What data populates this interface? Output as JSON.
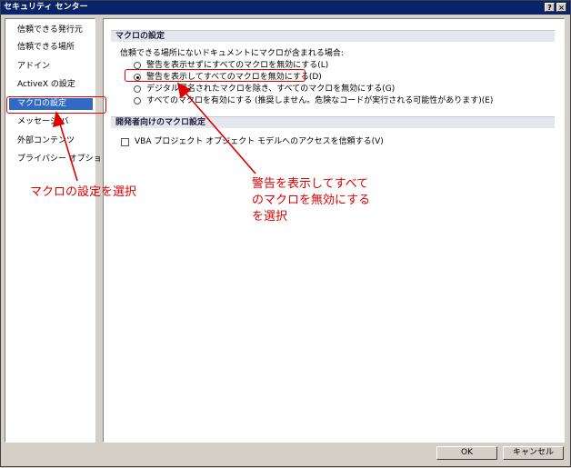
{
  "window": {
    "title": "セキュリティ センター",
    "help_label": "?",
    "close_label": "×"
  },
  "sidebar": {
    "items": [
      {
        "label": "信頼できる発行元"
      },
      {
        "label": "信頼できる場所"
      },
      {
        "label": "アドイン"
      },
      {
        "label": "ActiveX の設定"
      },
      {
        "label": "マクロの設定",
        "selected": true
      },
      {
        "label": "メッセージ バ"
      },
      {
        "label": "外部コンテンツ"
      },
      {
        "label": "プライバシー オプション"
      }
    ]
  },
  "macro_settings": {
    "heading": "マクロの設定",
    "intro": "信頼できる場所にないドキュメントにマクロが含まれる場合:",
    "options": [
      {
        "label": "警告を表示せずにすべてのマクロを無効にする(L)",
        "selected": false
      },
      {
        "label": "警告を表示してすべてのマクロを無効にする(D)",
        "selected": true
      },
      {
        "label": "デジタル署名されたマクロを除き、すべてのマクロを無効にする(G)",
        "selected": false
      },
      {
        "label": "すべてのマクロを有効にする (推奨しません。危険なコードが実行される可能性があります)(E)",
        "selected": false
      }
    ]
  },
  "developer_settings": {
    "heading": "開発者向けのマクロ設定",
    "vba_label": "VBA プロジェクト オブジェクト モデルへのアクセスを信頼する(V)",
    "vba_checked": false
  },
  "buttons": {
    "ok": "OK",
    "cancel": "キャンセル"
  },
  "annotations": {
    "left": "マクロの設定を選択",
    "right_lines": [
      "警告を表示してすべて",
      "のマクロを無効にする",
      "を選択"
    ],
    "color": "#e00000"
  }
}
